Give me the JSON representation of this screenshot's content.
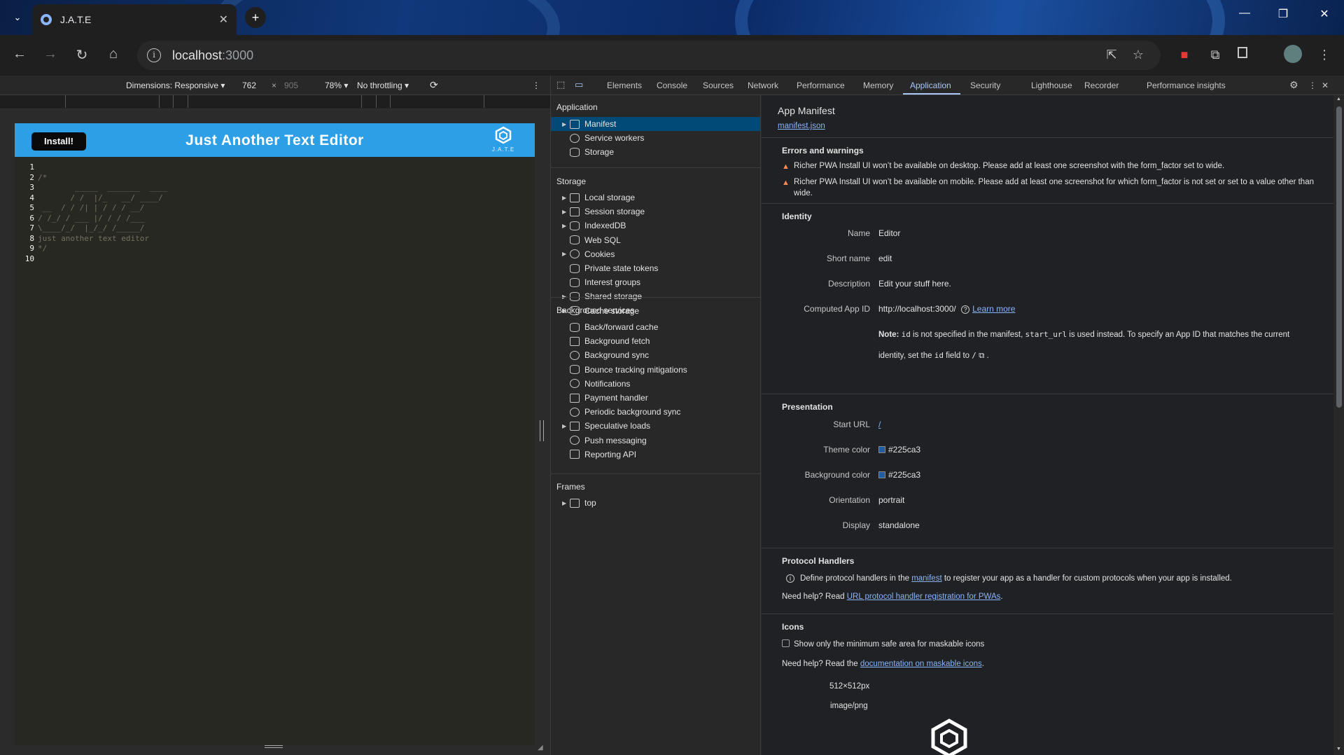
{
  "browser": {
    "tab_title": "J.A.T.E",
    "url_host": "localhost",
    "url_port": ":3000"
  },
  "device_toolbar": {
    "dimensions": "Dimensions: Responsive",
    "width": "762",
    "times": "×",
    "height": "905",
    "zoom": "78%",
    "throttling": "No throttling"
  },
  "app": {
    "install_label": "Install!",
    "title": "Just Another Text Editor",
    "logo_text": "J.A.T.E",
    "lines": [
      {
        "n": "1",
        "t": ""
      },
      {
        "n": "2",
        "t": "/*"
      },
      {
        "n": "3",
        "t": "        _____  _______  ____"
      },
      {
        "n": "4",
        "t": "       / /  |/_   __/ ____/"
      },
      {
        "n": "5",
        "t": " __  / / /| | / / / __/"
      },
      {
        "n": "6",
        "t": "/ /_/ / ___ |/ / / /___"
      },
      {
        "n": "7",
        "t": "\\____/_/  |_/_/ /_____/"
      },
      {
        "n": "8",
        "t": "just another text editor"
      },
      {
        "n": "9",
        "t": "*/"
      },
      {
        "n": "10",
        "t": ""
      }
    ]
  },
  "devtools": {
    "tabs": [
      "Elements",
      "Console",
      "Sources",
      "Network",
      "Performance",
      "Memory",
      "Application",
      "Security",
      "Lighthouse",
      "Recorder",
      "Performance insights"
    ],
    "active_tab": "Application",
    "sidebar": {
      "application_header": "Application",
      "application_items": [
        "Manifest",
        "Service workers",
        "Storage"
      ],
      "storage_header": "Storage",
      "storage_items": [
        "Local storage",
        "Session storage",
        "IndexedDB",
        "Web SQL",
        "Cookies",
        "Private state tokens",
        "Interest groups",
        "Shared storage",
        "Cache storage"
      ],
      "background_header": "Background services",
      "background_items": [
        "Back/forward cache",
        "Background fetch",
        "Background sync",
        "Bounce tracking mitigations",
        "Notifications",
        "Payment handler",
        "Periodic background sync",
        "Speculative loads",
        "Push messaging",
        "Reporting API"
      ],
      "frames_header": "Frames",
      "frames_items": [
        "top"
      ]
    },
    "manifest": {
      "title": "App Manifest",
      "link": "manifest.json",
      "errors_header": "Errors and warnings",
      "warning1": "Richer PWA Install UI won’t be available on desktop. Please add at least one screenshot with the form_factor set to wide.",
      "warning2": "Richer PWA Install UI won’t be available on mobile. Please add at least one screenshot for which form_factor is not set or set to a value other than wide.",
      "identity_header": "Identity",
      "name_label": "Name",
      "name_value": "Editor",
      "short_name_label": "Short name",
      "short_name_value": "edit",
      "description_label": "Description",
      "description_value": "Edit your stuff here.",
      "app_id_label": "Computed App ID",
      "app_id_value": "http://localhost:3000/",
      "learn_more": "Learn more",
      "note_bold": "Note:",
      "note_id": "id",
      "note_mid": " is not specified in the manifest, ",
      "note_start_url": "start_url",
      "note_end": " is used instead. To specify an App ID that matches the current",
      "note_line2a": "identity, set the ",
      "note_line2b": " field to ",
      "note_slash": "/",
      "presentation_header": "Presentation",
      "start_url_label": "Start URL",
      "start_url_value": "/",
      "theme_color_label": "Theme color",
      "theme_color_value": "#225ca3",
      "bg_color_label": "Background color",
      "bg_color_value": "#225ca3",
      "orientation_label": "Orientation",
      "orientation_value": "portrait",
      "display_label": "Display",
      "display_value": "standalone",
      "protocol_header": "Protocol Handlers",
      "protocol_text1": "Define protocol handlers in the ",
      "protocol_link": "manifest",
      "protocol_text2": " to register your app as a handler for custom protocols when your app is installed.",
      "help1_text": "Need help? Read ",
      "help1_link": "URL protocol handler registration for PWAs",
      "icons_header": "Icons",
      "maskable_checkbox": "Show only the minimum safe area for maskable icons",
      "help2_text": "Need help? Read the ",
      "help2_link": "documentation on maskable icons",
      "icon_size": "512×512px",
      "icon_type": "image/png"
    }
  },
  "colors": {
    "accent": "#a8c7fa",
    "app_header": "#2d9fe6",
    "theme": "#225ca3",
    "selected_row": "#004a77"
  }
}
